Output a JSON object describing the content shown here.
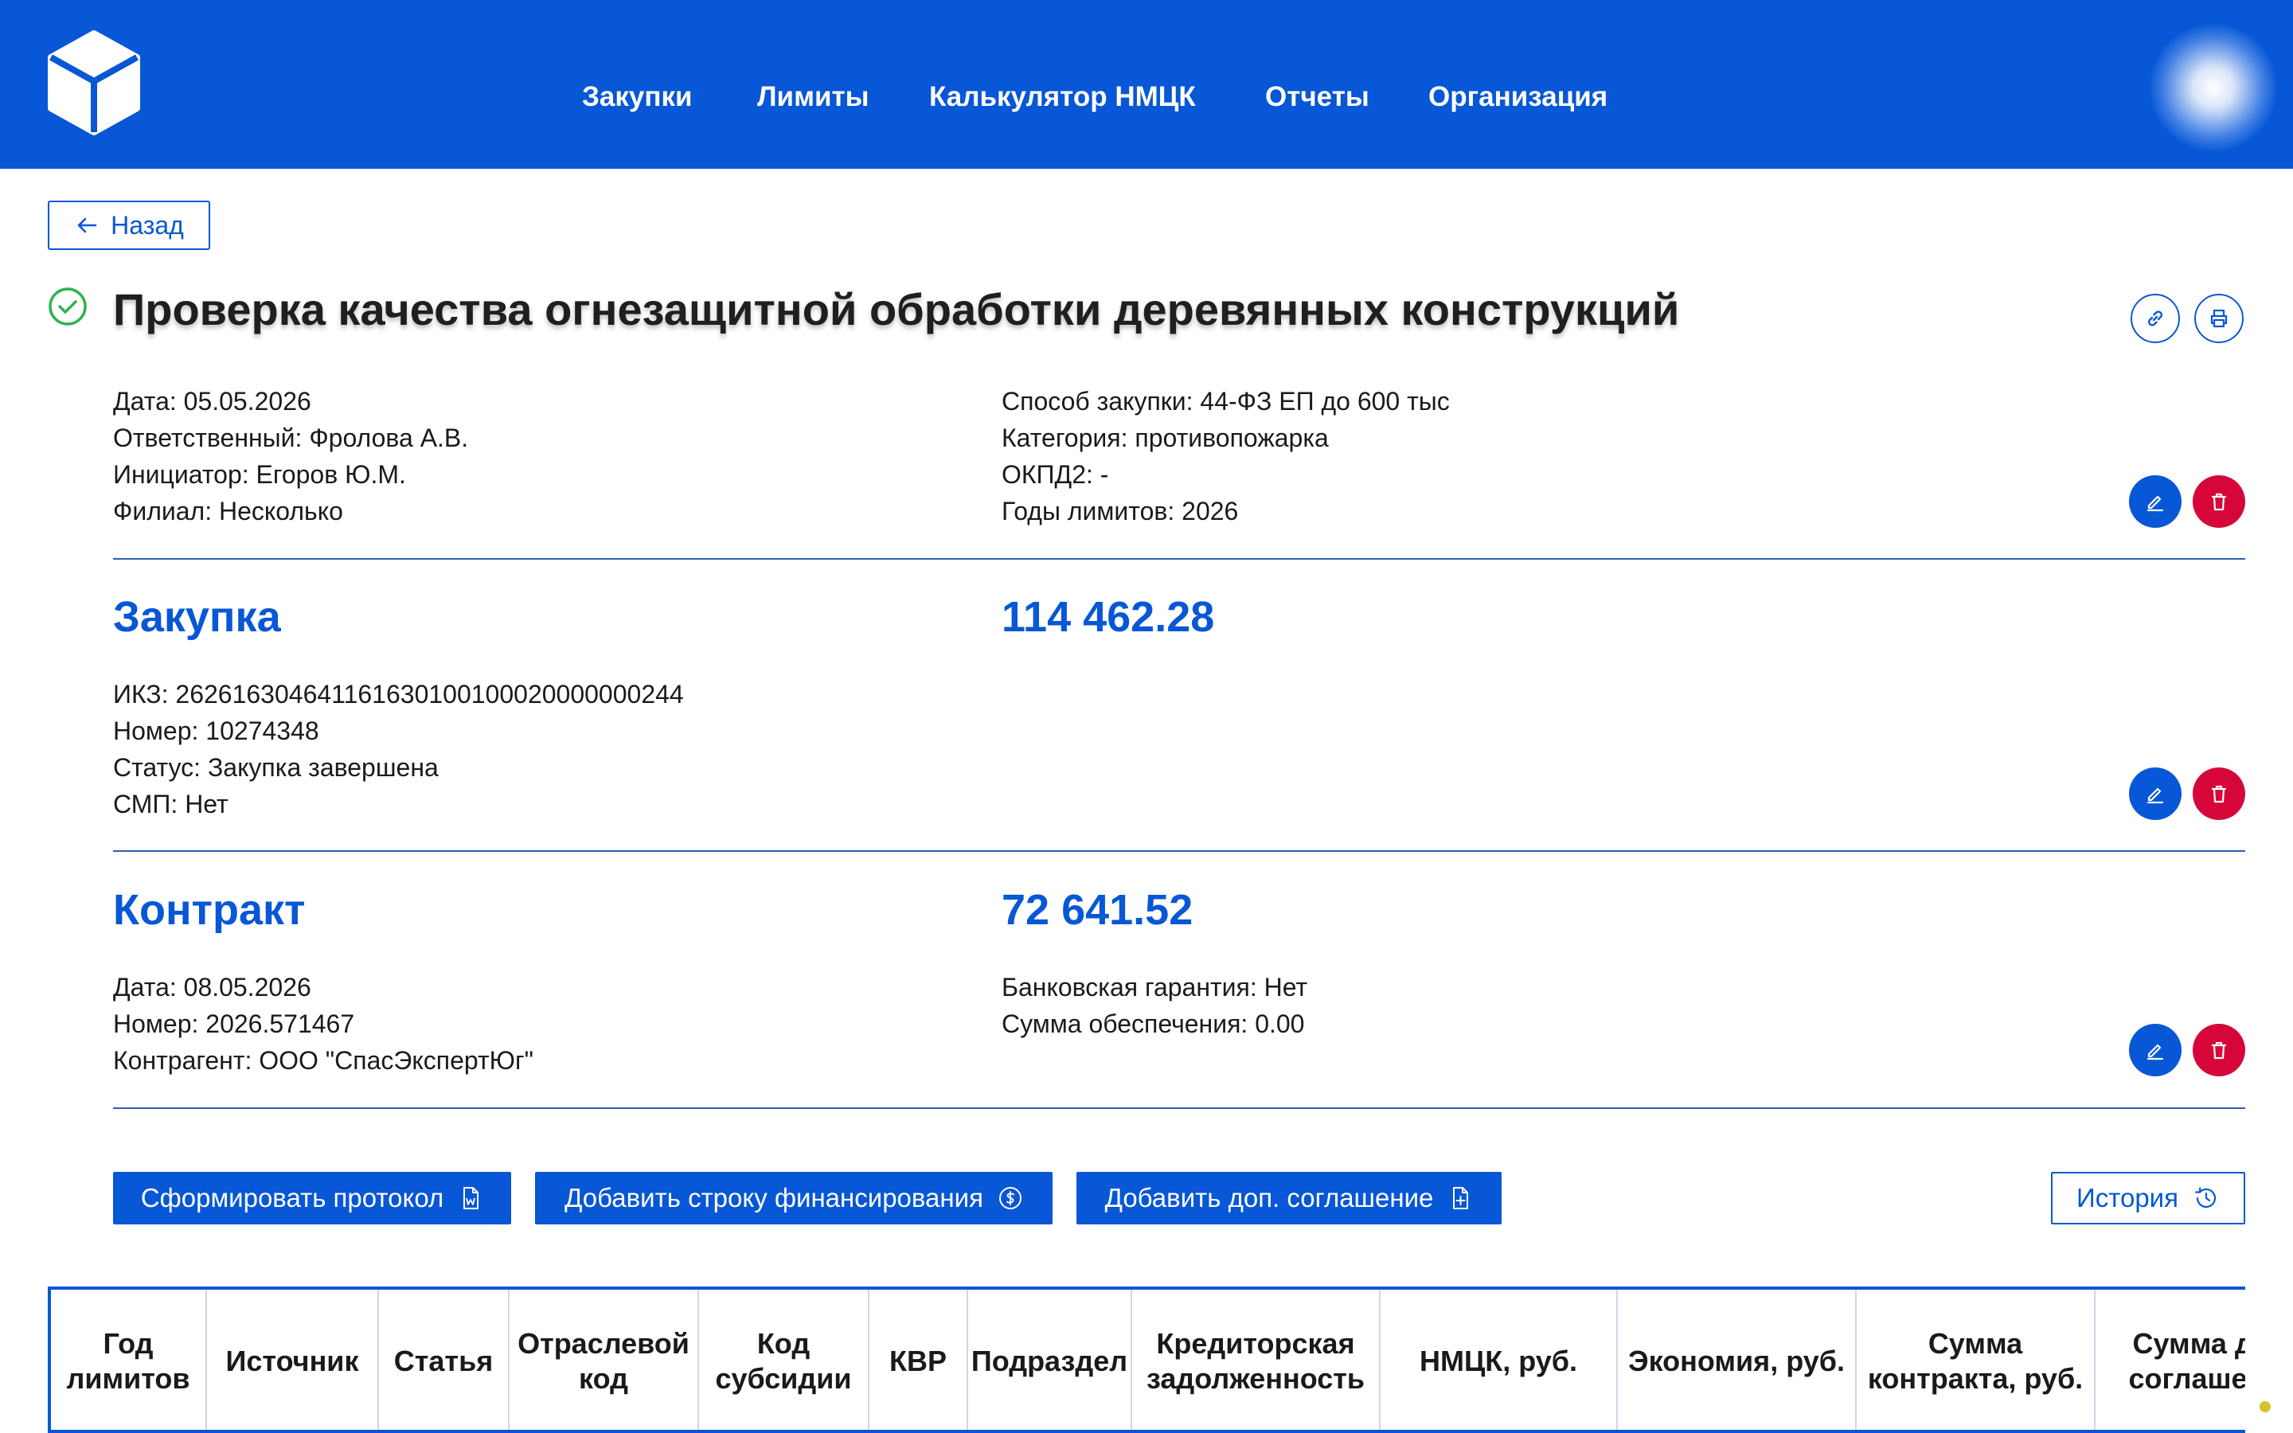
{
  "nav": [
    "Закупки",
    "Лимиты",
    "Калькулятор НМЦК",
    "Отчеты",
    "Организация"
  ],
  "back_label": "Назад",
  "title": "Проверка качества огнезащитной обработки деревянных конструкций",
  "general": {
    "left": [
      "Дата: 05.05.2026",
      "Ответственный: Фролова А.В.",
      "Инициатор: Егоров Ю.М.",
      "Филиал: Несколько"
    ],
    "right": [
      "Способ закупки: 44-ФЗ ЕП до 600 тыс",
      "Категория: противопожарка",
      "ОКПД2: -",
      "Годы лимитов: 2026"
    ]
  },
  "purchase": {
    "title": "Закупка",
    "amount": "114 462.28",
    "left": [
      "ИКЗ: 262616304641161630100100020000000244",
      "Номер: 10274348",
      "Статус: Закупка завершена",
      "СМП: Нет"
    ]
  },
  "contract": {
    "title": "Контракт",
    "amount": "72 641.52",
    "left": [
      "Дата: 08.05.2026",
      "Номер: 2026.571467",
      "Контрагент: ООО \"СпасЭкспертЮг\""
    ],
    "right": [
      "Банковская гарантия: Нет",
      "Сумма обеспечения: 0.00"
    ]
  },
  "actions": {
    "protocol": "Сформировать протокол",
    "add_financing": "Добавить строку финансирования",
    "add_agreement": "Добавить доп. соглашение",
    "history": "История"
  },
  "table_headers": [
    "Год лимитов",
    "Источник",
    "Статья",
    "Отраслевой код",
    "Код субсидии",
    "КВР",
    "Подраздел",
    "Кредиторская задолженность",
    "НМЦК, руб.",
    "Экономия, руб.",
    "Сумма контракта, руб.",
    "Сумма доп. соглашений"
  ],
  "colors": {
    "brand": "#0757d6",
    "danger": "#d7063a",
    "success": "#2eb24e"
  },
  "icons": [
    "cube-logo-icon",
    "arrow-left-icon",
    "check-circle-icon",
    "link-icon",
    "print-icon",
    "edit-icon",
    "trash-icon",
    "word-file-icon",
    "dollar-circle-icon",
    "file-plus-icon",
    "history-clock-icon"
  ]
}
